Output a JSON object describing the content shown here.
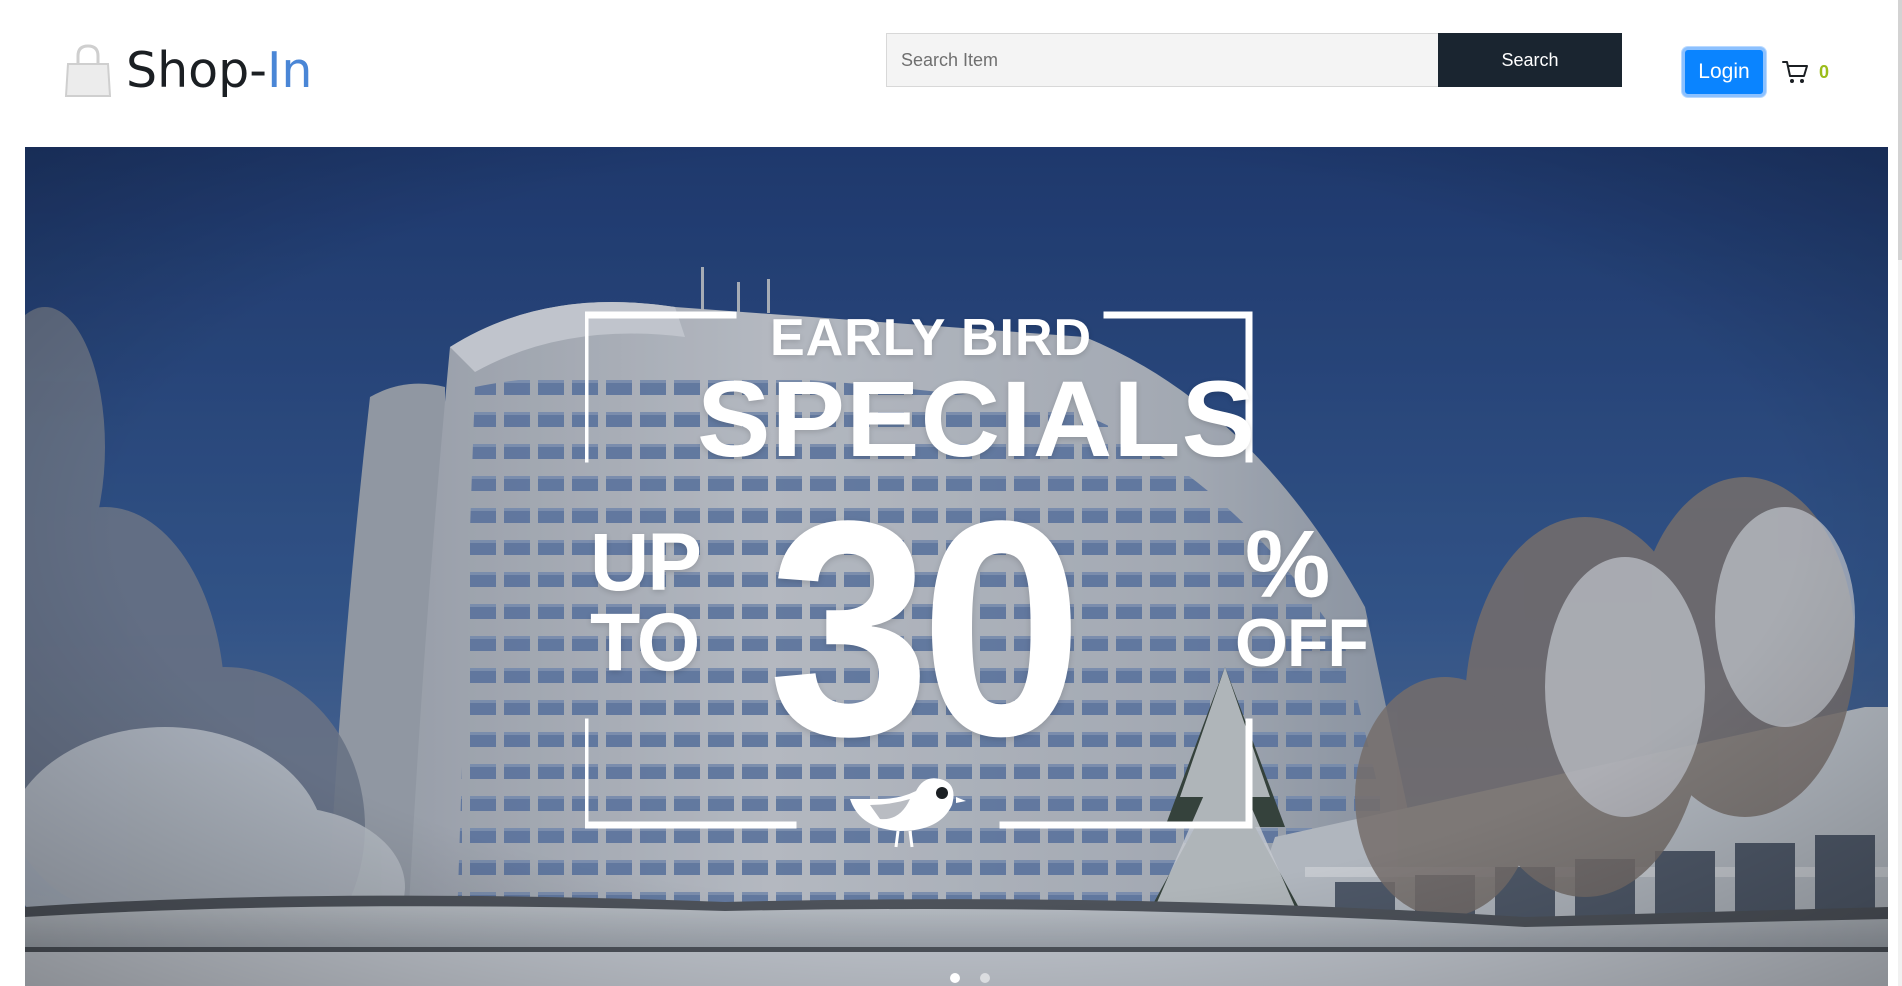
{
  "brand": {
    "name_prefix": "Shop-",
    "name_suffix": "In",
    "icon": "shopping-bag-icon",
    "accent_color": "#4a86d6"
  },
  "search": {
    "placeholder": "Search Item",
    "value": "",
    "button_label": "Search"
  },
  "header_actions": {
    "login_label": "Login",
    "cart_icon": "cart-icon",
    "cart_count": "0"
  },
  "hero": {
    "slide_count": 2,
    "active_slide": 1,
    "promo": {
      "line1": "EARLY BIRD",
      "line2": "SPECIALS",
      "up": "UP",
      "to": "TO",
      "value": "30",
      "percent": "%",
      "off": "OFF"
    }
  },
  "colors": {
    "search_button": "#1a2530",
    "login_button": "#0a84ff",
    "cart_count": "#9bbd1a"
  }
}
